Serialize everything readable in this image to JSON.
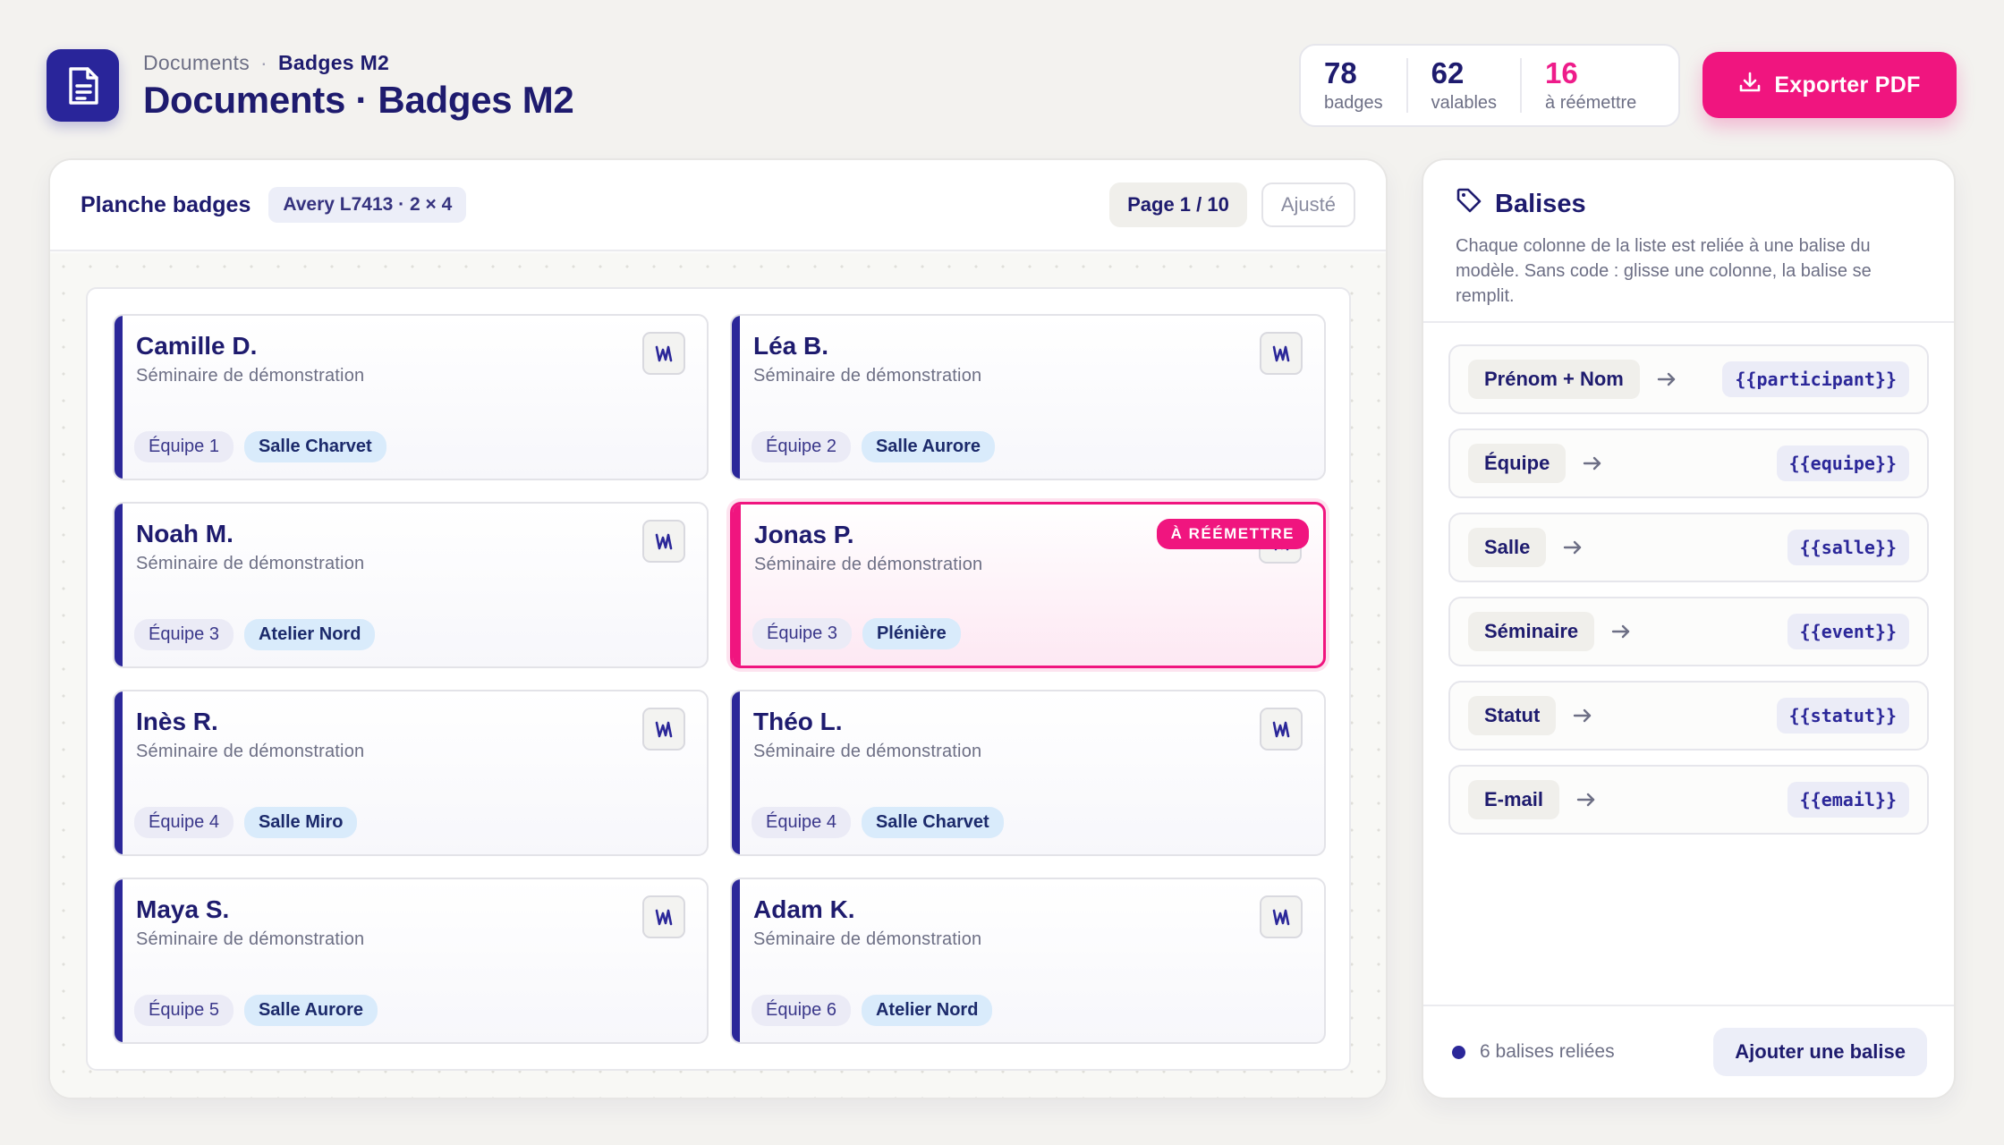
{
  "header": {
    "breadcrumb": {
      "root": "Documents",
      "separator": "·",
      "current": "Badges M2"
    },
    "title": "Documents · Badges M2",
    "stats": [
      {
        "value": "78",
        "label": "badges"
      },
      {
        "value": "62",
        "label": "valables"
      },
      {
        "value": "16",
        "label": "à réémettre"
      }
    ],
    "export_label": "Exporter PDF"
  },
  "sheet_panel": {
    "title": "Planche badges",
    "format": "Avery L7413 · 2 × 4",
    "page": "Page 1 / 10",
    "fit_label": "Ajusté",
    "badges": [
      {
        "name": "Camille D.",
        "event": "Séminaire de démonstration",
        "team": "Équipe 1",
        "room": "Salle Charvet"
      },
      {
        "name": "Léa B.",
        "event": "Séminaire de démonstration",
        "team": "Équipe 2",
        "room": "Salle Aurore"
      },
      {
        "name": "Noah M.",
        "event": "Séminaire de démonstration",
        "team": "Équipe 3",
        "room": "Atelier Nord"
      },
      {
        "name": "Jonas P.",
        "event": "Séminaire de démonstration",
        "team": "Équipe 3",
        "room": "Plénière",
        "flag": "À RÉÉMETTRE"
      },
      {
        "name": "Inès R.",
        "event": "Séminaire de démonstration",
        "team": "Équipe 4",
        "room": "Salle Miro"
      },
      {
        "name": "Théo L.",
        "event": "Séminaire de démonstration",
        "team": "Équipe 4",
        "room": "Salle Charvet"
      },
      {
        "name": "Maya S.",
        "event": "Séminaire de démonstration",
        "team": "Équipe 5",
        "room": "Salle Aurore"
      },
      {
        "name": "Adam K.",
        "event": "Séminaire de démonstration",
        "team": "Équipe 6",
        "room": "Atelier Nord"
      }
    ]
  },
  "tags_panel": {
    "title": "Balises",
    "description": "Chaque colonne de la liste est reliée à une balise du modèle. Sans code : glisse une colonne, la balise se remplit.",
    "mappings": [
      {
        "column": "Prénom + Nom",
        "tag": "{{participant}}"
      },
      {
        "column": "Équipe",
        "tag": "{{equipe}}"
      },
      {
        "column": "Salle",
        "tag": "{{salle}}"
      },
      {
        "column": "Séminaire",
        "tag": "{{event}}"
      },
      {
        "column": "Statut",
        "tag": "{{statut}}"
      },
      {
        "column": "E-mail",
        "tag": "{{email}}"
      }
    ],
    "footer_status": "6 balises reliées",
    "add_label": "Ajouter une balise"
  },
  "colors": {
    "primary": "#29259a",
    "accent": "#f0157f",
    "background": "#f3f2ef"
  },
  "icons": [
    "document-icon",
    "download-icon",
    "tag-icon",
    "arrow-right-icon",
    "logo-w-icon"
  ]
}
